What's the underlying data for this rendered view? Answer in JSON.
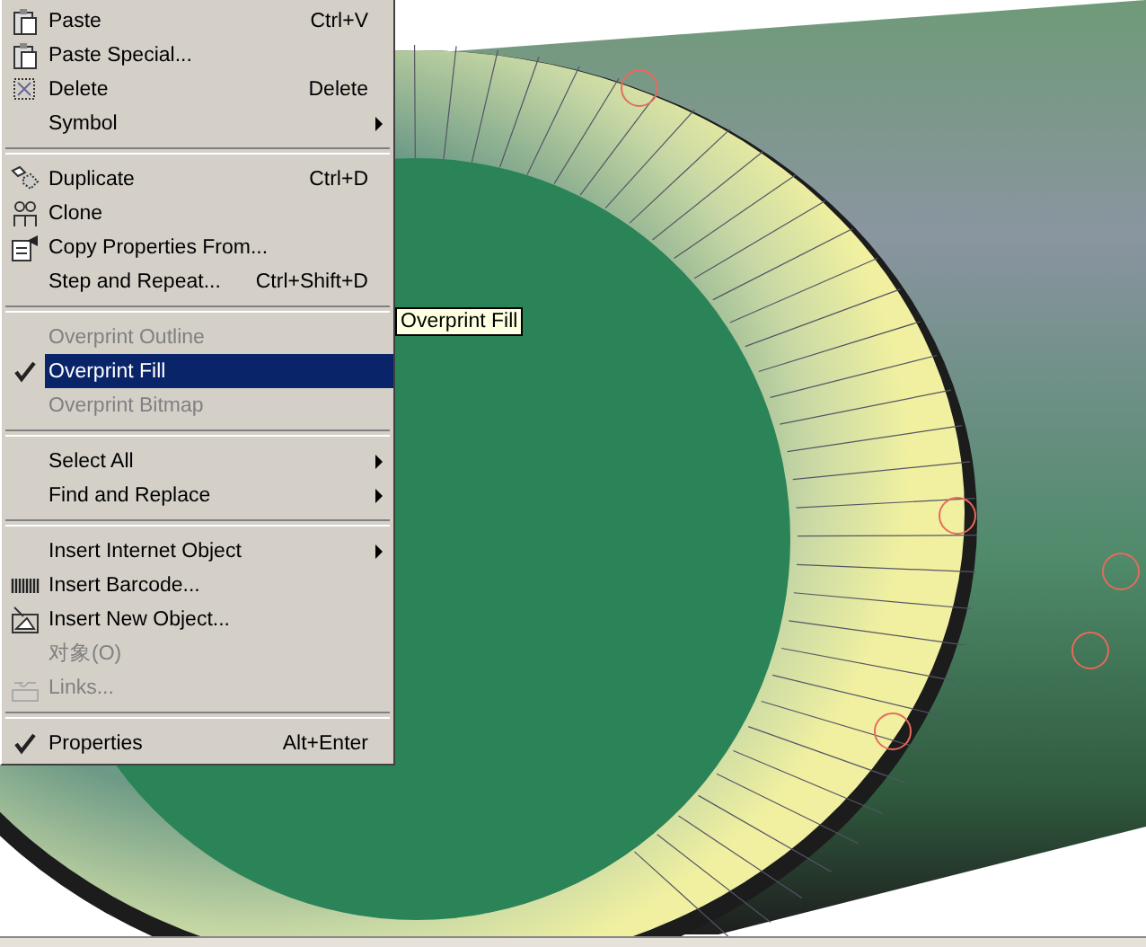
{
  "context_menu": {
    "items": [
      {
        "kind": "item",
        "label": "Paste",
        "shortcut": "Ctrl+V",
        "disabled": false,
        "checked": false,
        "selected": false,
        "submenu": false
      },
      {
        "kind": "item",
        "label": "Paste Special...",
        "disabled": false,
        "checked": false,
        "selected": false,
        "submenu": false
      },
      {
        "kind": "item",
        "label": "Delete",
        "shortcut": "Delete",
        "disabled": false,
        "checked": false,
        "selected": false,
        "submenu": false
      },
      {
        "kind": "item",
        "label": "Symbol",
        "disabled": false,
        "checked": false,
        "selected": false,
        "submenu": true
      },
      {
        "kind": "separator"
      },
      {
        "kind": "item",
        "label": "Duplicate",
        "shortcut": "Ctrl+D",
        "disabled": false,
        "checked": false,
        "selected": false,
        "submenu": false
      },
      {
        "kind": "item",
        "label": "Clone",
        "disabled": false,
        "checked": false,
        "selected": false,
        "submenu": false
      },
      {
        "kind": "item",
        "label": "Copy Properties From...",
        "disabled": false,
        "checked": false,
        "selected": false,
        "submenu": false
      },
      {
        "kind": "item",
        "label": "Step and Repeat...",
        "shortcut": "Ctrl+Shift+D",
        "disabled": false,
        "checked": false,
        "selected": false,
        "submenu": false
      },
      {
        "kind": "separator"
      },
      {
        "kind": "item",
        "label": "Overprint Outline",
        "disabled": true,
        "checked": false,
        "selected": false,
        "submenu": false
      },
      {
        "kind": "item",
        "label": "Overprint Fill",
        "disabled": false,
        "checked": true,
        "selected": true,
        "submenu": false
      },
      {
        "kind": "item",
        "label": "Overprint Bitmap",
        "disabled": true,
        "checked": false,
        "selected": false,
        "submenu": false
      },
      {
        "kind": "separator"
      },
      {
        "kind": "item",
        "label": "Select All",
        "disabled": false,
        "checked": false,
        "selected": false,
        "submenu": true
      },
      {
        "kind": "item",
        "label": "Find and Replace",
        "disabled": false,
        "checked": false,
        "selected": false,
        "submenu": true
      },
      {
        "kind": "separator"
      },
      {
        "kind": "item",
        "label": "Insert Internet Object",
        "disabled": false,
        "checked": false,
        "selected": false,
        "submenu": true
      },
      {
        "kind": "item",
        "label": "Insert Barcode...",
        "disabled": false,
        "checked": false,
        "selected": false,
        "submenu": false
      },
      {
        "kind": "item",
        "label": "Insert New Object...",
        "disabled": false,
        "checked": false,
        "selected": false,
        "submenu": false
      },
      {
        "kind": "item",
        "label": "对象(O)",
        "disabled": true,
        "checked": false,
        "selected": false,
        "submenu": false
      },
      {
        "kind": "item",
        "label": "Links...",
        "disabled": true,
        "checked": false,
        "selected": false,
        "submenu": false
      },
      {
        "kind": "separator"
      },
      {
        "kind": "item",
        "label": "Properties",
        "shortcut": "Alt+Enter",
        "disabled": false,
        "checked": true,
        "selected": false,
        "submenu": false
      }
    ]
  },
  "tooltip": {
    "text": "Overprint Fill"
  }
}
